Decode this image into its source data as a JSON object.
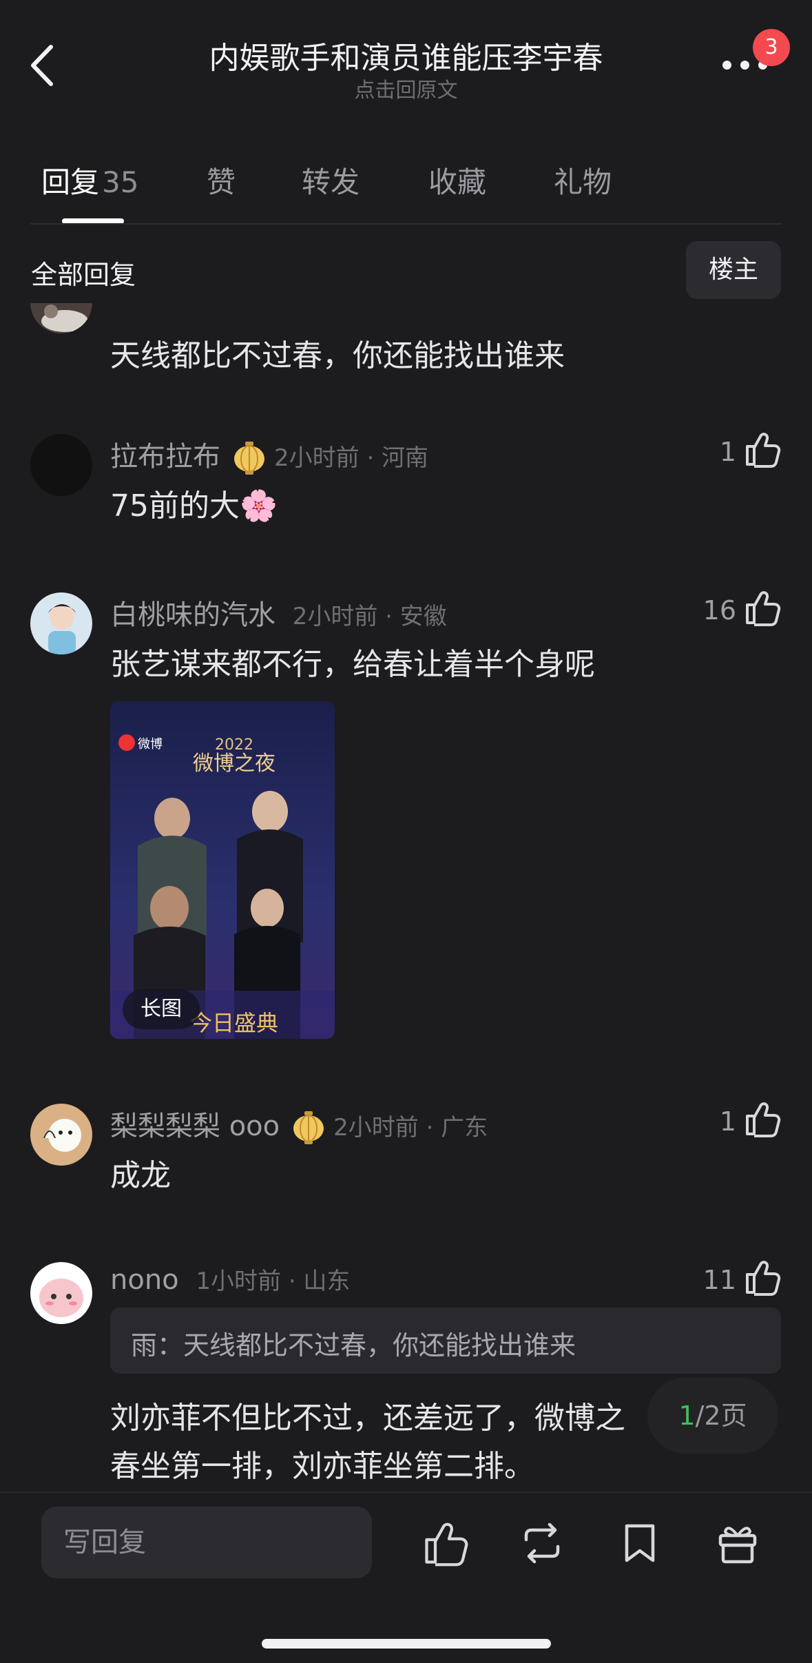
{
  "header": {
    "title": "内娱歌手和演员谁能压李宇春",
    "subtitle": "点击回原文",
    "notification_count": "3"
  },
  "tabs": [
    {
      "label": "回复",
      "count": "35",
      "active": true
    },
    {
      "label": "赞"
    },
    {
      "label": "转发"
    },
    {
      "label": "收藏"
    },
    {
      "label": "礼物"
    }
  ],
  "filter": {
    "label": "全部回复",
    "op_button": "楼主"
  },
  "comments": [
    {
      "content": "天线都比不过春，你还能找出谁来"
    },
    {
      "username": "拉布拉布",
      "medal_icon": "lantern-medal-icon",
      "meta": "2小时前 · 河南",
      "likes": "1",
      "content": "75前的大🌸"
    },
    {
      "username": "白桃味的汽水",
      "meta": "2小时前 · 安徽",
      "likes": "16",
      "content": "张艺谋来都不行，给春让着半个身呢",
      "image_tag": "长图",
      "image_text": {
        "brand": "微博",
        "year": "2022",
        "event": "微博之夜",
        "banner": "今日盛典"
      }
    },
    {
      "username": "梨梨梨梨 ooo",
      "medal_icon": "lantern-medal-icon",
      "meta": "2小时前 · 广东",
      "likes": "1",
      "content": "成龙"
    },
    {
      "username": "nono",
      "meta": "1小时前 · 山东",
      "likes": "11",
      "quote": "雨：天线都比不过春，你还能找出谁来",
      "content_line1": "刘亦菲不但比不过，还差远了，微博之",
      "content_line2": "春坐第一排，刘亦菲坐第二排。"
    }
  ],
  "pager": {
    "current": "1",
    "total": "/2页"
  },
  "bottom_bar": {
    "reply_placeholder": "写回复",
    "icons": [
      "like-icon",
      "repost-icon",
      "bookmark-icon",
      "gift-icon"
    ]
  },
  "colors": {
    "background": "#1c1c1e",
    "badge": "#f24a4f",
    "pager_current": "#3fbf5f"
  }
}
